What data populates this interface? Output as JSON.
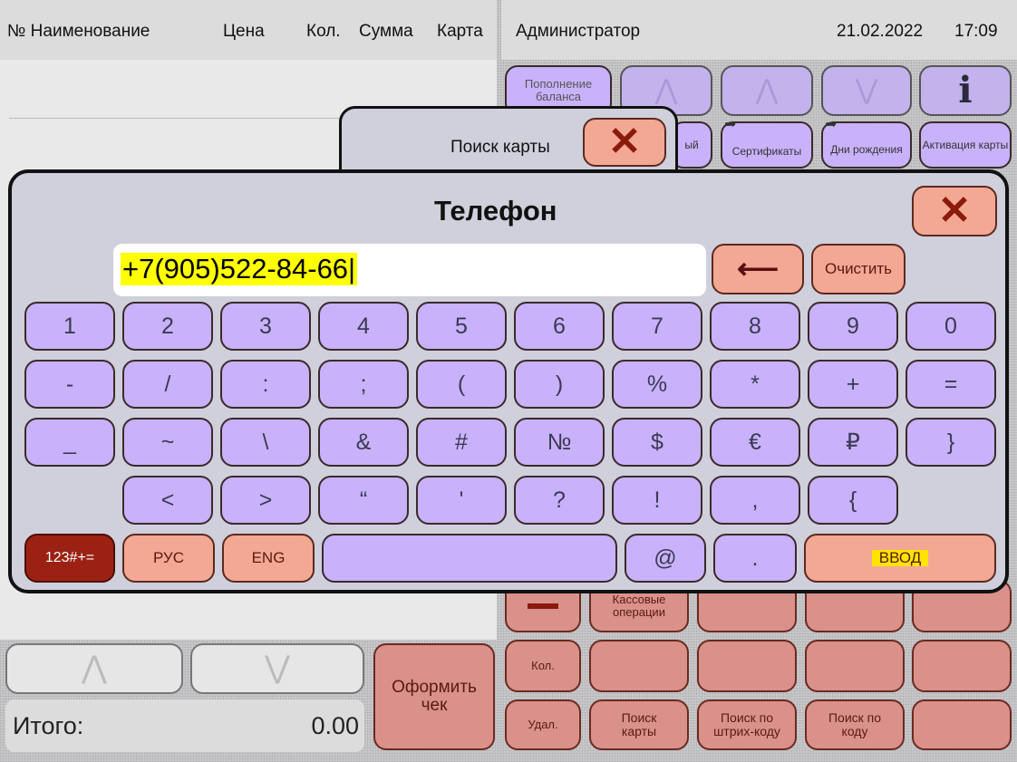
{
  "header": {
    "col_name": "№ Наименование",
    "col_price": "Цена",
    "col_qty": "Кол.",
    "col_sum": "Сумма",
    "col_card": "Карта",
    "user": "Администратор",
    "date": "21.02.2022",
    "time": "17:09"
  },
  "top_buttons": {
    "balance": "Пополнение баланса",
    "partial": "ый",
    "certificates": "Сертификаты",
    "birthdays": "Дни рождения",
    "activation": "Активация карты",
    "info_icon": "i"
  },
  "search_dialog": {
    "title": "Поиск карты",
    "close_icon": "close-icon"
  },
  "phone_dialog": {
    "title": "Телефон",
    "value": "+7(905)522-84-66|",
    "clear_label": "Очистить",
    "backspace_icon": "⟵"
  },
  "keyboard": {
    "row1": [
      "1",
      "2",
      "3",
      "4",
      "5",
      "6",
      "7",
      "8",
      "9",
      "0"
    ],
    "row2": [
      "-",
      "/",
      ":",
      ";",
      "(",
      ")",
      "%",
      "*",
      "+",
      "="
    ],
    "row3": [
      "_",
      "~",
      "\\",
      "&",
      "#",
      "№",
      "$",
      "€",
      "₽",
      "}"
    ],
    "row4": [
      "<",
      ">",
      "“",
      "'",
      "?",
      "!",
      ",",
      "{"
    ],
    "mode_symbols": "123#+=",
    "mode_rus": "РУС",
    "mode_eng": "ENG",
    "at": "@",
    "dot": ".",
    "enter": "ВВОД"
  },
  "bottom": {
    "total_label": "Итого:",
    "total_value": "0.00",
    "checkout": "Оформить чек",
    "cash_ops": "Кассовые операции",
    "qty": "Кол.",
    "delete": "Удал.",
    "search_card": "Поиск карты",
    "search_barcode": "Поиск по штрих-коду",
    "search_code": "Поиск по коду"
  },
  "colors": {
    "violet": "#c9b2fb",
    "salmon": "#f3a894",
    "dark_red": "#9b2213",
    "highlight": "#ffff00"
  }
}
